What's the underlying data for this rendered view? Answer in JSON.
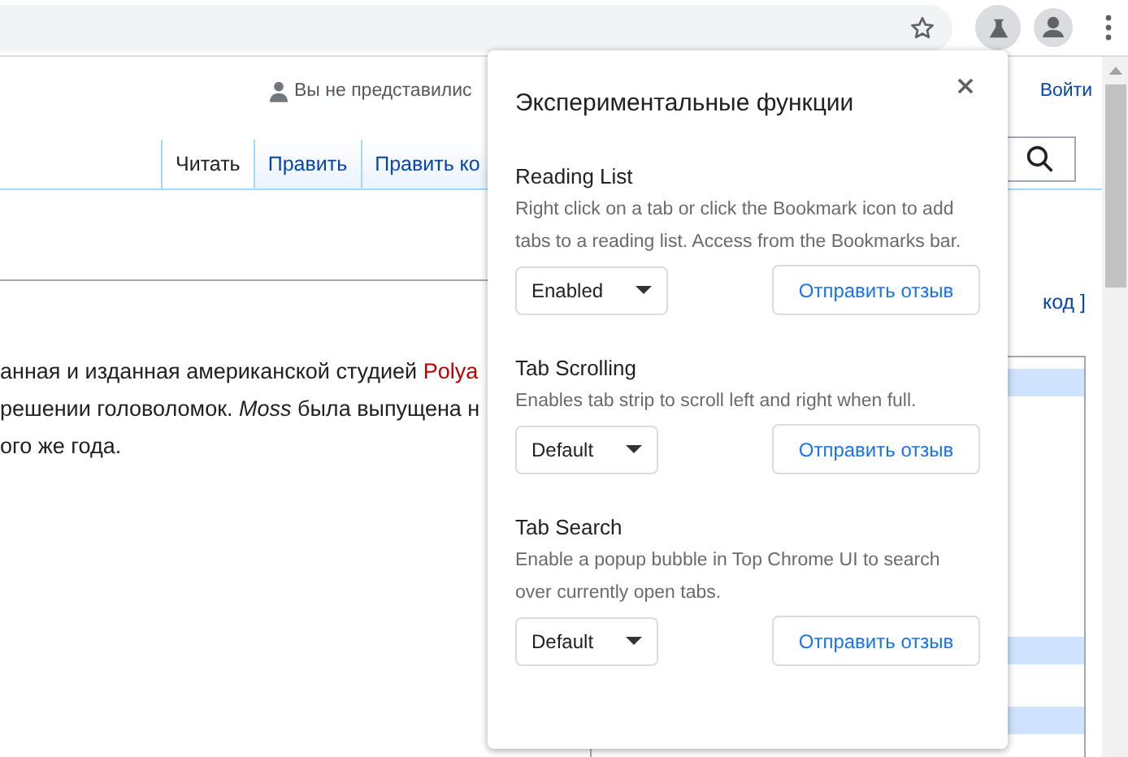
{
  "page": {
    "user_status": "Вы не представилис",
    "login_link": "Войти",
    "tabs": [
      {
        "label": "Читать",
        "selected": true
      },
      {
        "label": "Править",
        "selected": false
      },
      {
        "label": "Править ко",
        "selected": false
      }
    ],
    "edit_link": "код ]",
    "article_lines": [
      [
        {
          "kind": "plain",
          "text": "анная и изданная американской студией "
        },
        {
          "kind": "link",
          "text": "Polya"
        }
      ],
      [
        {
          "kind": "plain",
          "text": "решении головоломок. "
        },
        {
          "kind": "italic",
          "text": "Moss"
        },
        {
          "kind": "plain",
          "text": " была выпущена н"
        }
      ],
      [
        {
          "kind": "plain",
          "text": "ого же года."
        }
      ]
    ]
  },
  "experiments_popup": {
    "title": "Экспериментальные функции",
    "features": [
      {
        "name": "Reading List",
        "description": "Right click on a tab or click the Bookmark icon to add tabs to a reading list. Access from the Bookmarks bar.",
        "state": "Enabled",
        "feedback_button": "Отправить отзыв"
      },
      {
        "name": "Tab Scrolling",
        "description": "Enables tab strip to scroll left and right when full.",
        "state": "Default",
        "feedback_button": "Отправить отзыв"
      },
      {
        "name": "Tab Search",
        "description": "Enable a popup bubble in Top Chrome UI to search over currently open tabs.",
        "state": "Default",
        "feedback_button": "Отправить отзыв"
      }
    ]
  }
}
